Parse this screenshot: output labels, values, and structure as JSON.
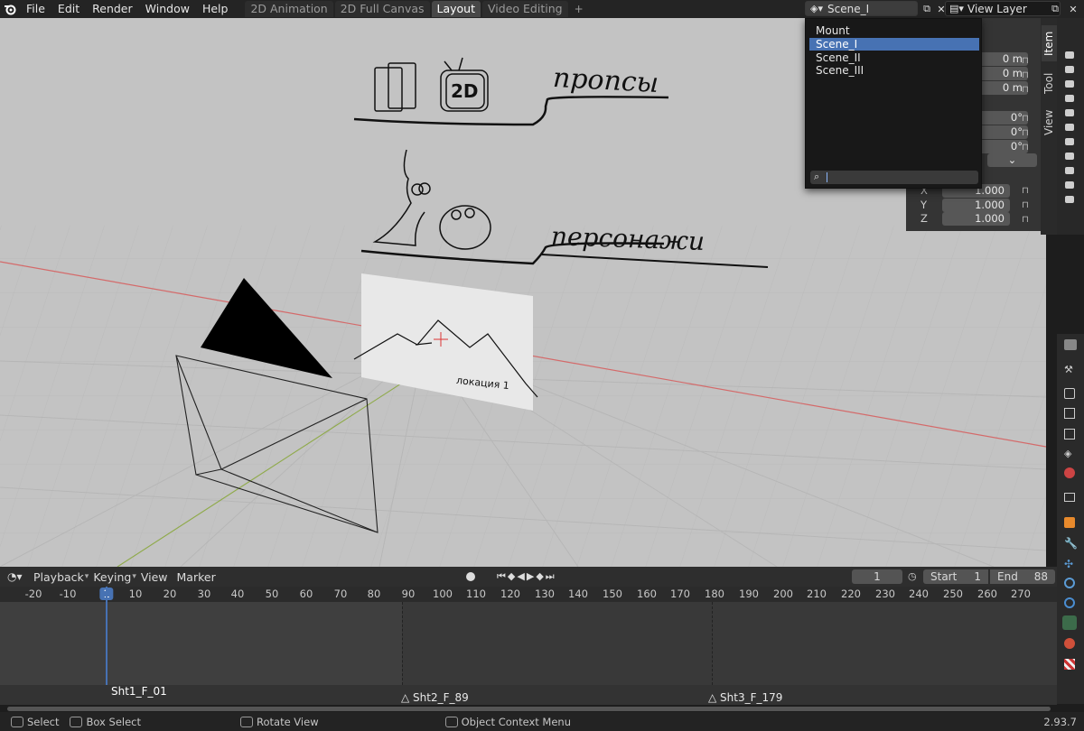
{
  "menu": [
    "File",
    "Edit",
    "Render",
    "Window",
    "Help"
  ],
  "workspaces": [
    {
      "label": "2D Animation",
      "active": false
    },
    {
      "label": "2D Full Canvas",
      "active": false
    },
    {
      "label": "Layout",
      "active": true
    },
    {
      "label": "Video Editing",
      "active": false
    }
  ],
  "header": {
    "scene": "Scene_I",
    "view_layer": "View Layer"
  },
  "scene_dropdown": {
    "items": [
      "Mount",
      "Scene_I",
      "Scene_II",
      "Scene_III"
    ],
    "selected": "Scene_I",
    "search_value": ""
  },
  "npanel": {
    "tabs": [
      "Item",
      "Tool",
      "View"
    ],
    "location_values": [
      "0 m",
      "0 m",
      "0 m"
    ],
    "rotation_values": [
      "0°",
      "0°",
      "0°"
    ],
    "scale_rows": [
      {
        "axis": "X",
        "value": "1.000"
      },
      {
        "axis": "Y",
        "value": "1.000"
      },
      {
        "axis": "Z",
        "value": "1.000"
      }
    ]
  },
  "viewport_texts": {
    "props_label": "пропсы",
    "characters_label": "персонажи",
    "location_label": "локация 1"
  },
  "timeline": {
    "menus": [
      "Playback",
      "Keying",
      "View",
      "Marker"
    ],
    "current_frame": "1",
    "start_label": "Start",
    "start": "1",
    "end_label": "End",
    "end": "88",
    "frames": [
      "-20",
      "-10",
      "1",
      "10",
      "20",
      "30",
      "40",
      "50",
      "60",
      "70",
      "80",
      "90",
      "100",
      "110",
      "120",
      "130",
      "140",
      "150",
      "160",
      "170",
      "180",
      "190",
      "200",
      "210",
      "220",
      "230",
      "240",
      "250",
      "260",
      "270"
    ],
    "markers": [
      {
        "label": "Sht1_F_01"
      },
      {
        "label": "Sht2_F_89"
      },
      {
        "label": "Sht3_F_179"
      }
    ]
  },
  "status": {
    "select": "Select",
    "box_select": "Box Select",
    "rotate": "Rotate View",
    "context": "Object Context Menu",
    "version": "2.93.7"
  },
  "colors": {
    "selection": "#4772b3",
    "viewport_bg": "#c3c3c3",
    "x_axis": "#d46a6a",
    "y_axis": "#8faa4a"
  },
  "icons": [
    "blender-logo-icon",
    "scene-icon",
    "view-layer-icon",
    "camera-icon",
    "search-icon",
    "play-icon",
    "record-icon",
    "stopwatch-icon",
    "lock-icon",
    "wrench-icon",
    "render-icon",
    "output-icon"
  ]
}
